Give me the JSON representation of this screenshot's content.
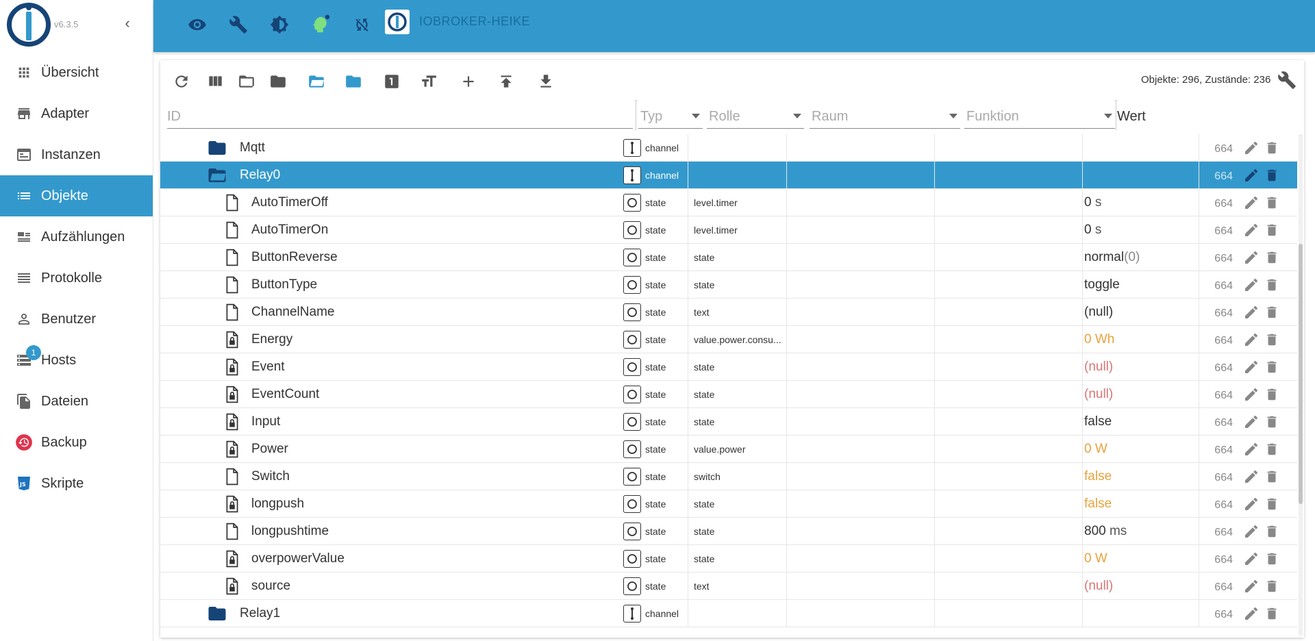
{
  "app": {
    "version": "v6.3.5",
    "instance_title": "IOBROKER-HEIKE"
  },
  "sidebar": {
    "items": [
      {
        "label": "Übersicht",
        "icon": "grid-icon"
      },
      {
        "label": "Adapter",
        "icon": "store-icon"
      },
      {
        "label": "Instanzen",
        "icon": "instances-icon"
      },
      {
        "label": "Objekte",
        "icon": "list-icon",
        "active": true
      },
      {
        "label": "Aufzählungen",
        "icon": "enum-icon"
      },
      {
        "label": "Protokolle",
        "icon": "lines-icon"
      },
      {
        "label": "Benutzer",
        "icon": "user-icon"
      },
      {
        "label": "Hosts",
        "icon": "hosts-icon",
        "badge": "1"
      },
      {
        "label": "Dateien",
        "icon": "files-icon"
      },
      {
        "label": "Backup",
        "icon": "backup-icon"
      },
      {
        "label": "Skripte",
        "icon": "js-icon"
      }
    ]
  },
  "topbar": {
    "icons": [
      "eye-icon",
      "wrench-icon",
      "theme-icon",
      "expert-mode-icon",
      "sync-off-icon"
    ]
  },
  "toolbar": {
    "count_text": "Objekte: 296, Zustände: 236"
  },
  "filters": {
    "id_placeholder": "ID",
    "type_placeholder": "Typ",
    "role_placeholder": "Rolle",
    "room_placeholder": "Raum",
    "function_placeholder": "Funktion",
    "value_header": "Wert"
  },
  "colors": {
    "accent": "#3399cc",
    "dark_blue": "#164477",
    "orange_value": "#e8a33b",
    "red_value": "#d97575"
  },
  "rows": [
    {
      "name": "Mqtt",
      "kind": "folder",
      "type": "channel",
      "role": "",
      "value": "",
      "acl": "664"
    },
    {
      "name": "Relay0",
      "kind": "folder-open",
      "type": "channel",
      "role": "",
      "value": "",
      "acl": "664",
      "selected": true
    },
    {
      "name": "AutoTimerOff",
      "kind": "file",
      "type": "state",
      "role": "level.timer",
      "value": "0",
      "unit": "s",
      "acl": "664"
    },
    {
      "name": "AutoTimerOn",
      "kind": "file",
      "type": "state",
      "role": "level.timer",
      "value": "0",
      "unit": "s",
      "acl": "664"
    },
    {
      "name": "ButtonReverse",
      "kind": "file",
      "type": "state",
      "role": "state",
      "value": "normal",
      "unit": "(0)",
      "acl": "664"
    },
    {
      "name": "ButtonType",
      "kind": "file",
      "type": "state",
      "role": "state",
      "value": "toggle",
      "acl": "664"
    },
    {
      "name": "ChannelName",
      "kind": "file",
      "type": "state",
      "role": "text",
      "value": "(null)",
      "acl": "664"
    },
    {
      "name": "Energy",
      "kind": "file-lock",
      "type": "state",
      "role": "value.power.consu...",
      "value": "0 Wh",
      "style": "orange",
      "acl": "664"
    },
    {
      "name": "Event",
      "kind": "file-lock",
      "type": "state",
      "role": "state",
      "value": "(null)",
      "style": "red",
      "acl": "664"
    },
    {
      "name": "EventCount",
      "kind": "file-lock",
      "type": "state",
      "role": "state",
      "value": "(null)",
      "style": "red",
      "acl": "664"
    },
    {
      "name": "Input",
      "kind": "file-lock",
      "type": "state",
      "role": "state",
      "value": "false",
      "acl": "664"
    },
    {
      "name": "Power",
      "kind": "file-lock",
      "type": "state",
      "role": "value.power",
      "value": "0 W",
      "style": "orange",
      "acl": "664"
    },
    {
      "name": "Switch",
      "kind": "file",
      "type": "state",
      "role": "switch",
      "value": "false",
      "style": "orange",
      "acl": "664"
    },
    {
      "name": "longpush",
      "kind": "file-lock",
      "type": "state",
      "role": "state",
      "value": "false",
      "style": "orange",
      "acl": "664"
    },
    {
      "name": "longpushtime",
      "kind": "file",
      "type": "state",
      "role": "state",
      "value": "800",
      "unit": "ms",
      "acl": "664"
    },
    {
      "name": "overpowerValue",
      "kind": "file-lock",
      "type": "state",
      "role": "state",
      "value": "0 W",
      "style": "orange",
      "acl": "664"
    },
    {
      "name": "source",
      "kind": "file-lock",
      "type": "state",
      "role": "text",
      "value": "(null)",
      "style": "red",
      "acl": "664"
    },
    {
      "name": "Relay1",
      "kind": "folder",
      "type": "channel",
      "role": "",
      "value": "",
      "acl": "664"
    }
  ]
}
